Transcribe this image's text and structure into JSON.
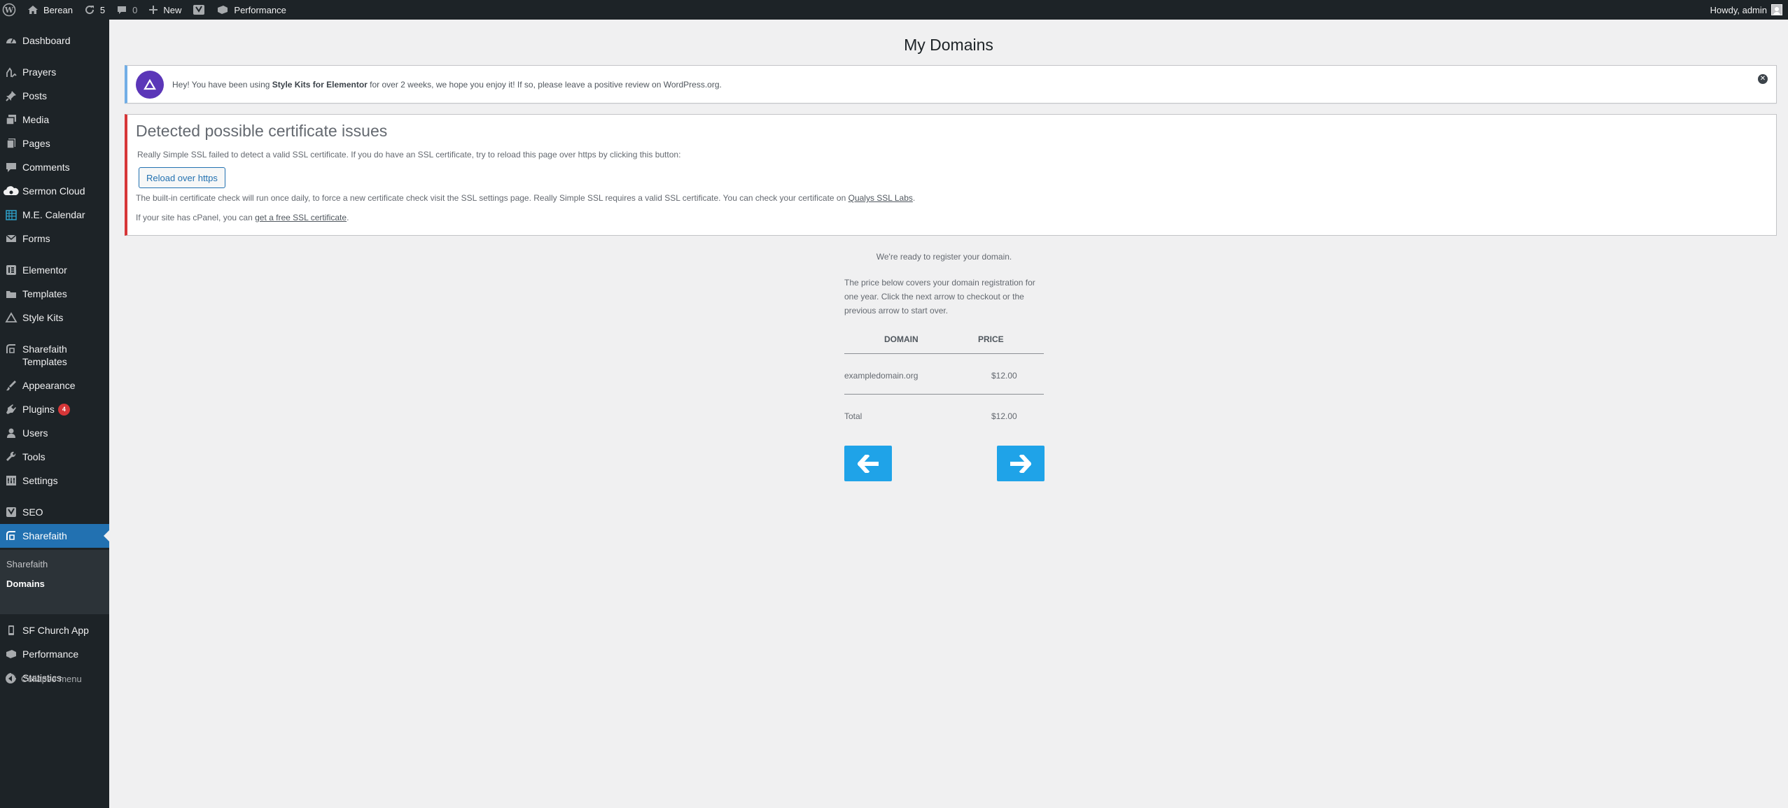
{
  "adminbar": {
    "site_name": "Berean",
    "updates_count": "5",
    "comments_count": "0",
    "new_label": "New",
    "performance_label": "Performance",
    "howdy": "Howdy, admin"
  },
  "sidebar": {
    "items": [
      {
        "label": "Dashboard",
        "icon": "dashboard-icon"
      },
      {
        "label": "Prayers",
        "icon": "prayers-icon"
      },
      {
        "label": "Posts",
        "icon": "posts-icon"
      },
      {
        "label": "Media",
        "icon": "media-icon"
      },
      {
        "label": "Pages",
        "icon": "pages-icon"
      },
      {
        "label": "Comments",
        "icon": "comments-icon"
      },
      {
        "label": "Sermon Cloud",
        "icon": "cloud-icon"
      },
      {
        "label": "M.E. Calendar",
        "icon": "calendar-icon"
      },
      {
        "label": "Forms",
        "icon": "forms-icon"
      },
      {
        "label": "Elementor",
        "icon": "elementor-icon"
      },
      {
        "label": "Templates",
        "icon": "templates-icon"
      },
      {
        "label": "Style Kits",
        "icon": "style-kits-icon"
      },
      {
        "label": "Sharefaith Templates",
        "icon": "sharefaith-templates-icon"
      },
      {
        "label": "Appearance",
        "icon": "appearance-icon"
      },
      {
        "label": "Plugins",
        "icon": "plugins-icon",
        "badge": "4"
      },
      {
        "label": "Users",
        "icon": "users-icon"
      },
      {
        "label": "Tools",
        "icon": "tools-icon"
      },
      {
        "label": "Settings",
        "icon": "settings-icon"
      },
      {
        "label": "SEO",
        "icon": "seo-icon"
      },
      {
        "label": "Sharefaith",
        "icon": "sharefaith-icon"
      },
      {
        "label": "SF Church App",
        "icon": "phone-icon"
      },
      {
        "label": "Performance",
        "icon": "performance-icon"
      },
      {
        "label": "Statistics",
        "icon": "statistics-icon"
      }
    ],
    "submenu": [
      "Sharefaith",
      "Domains"
    ],
    "collapse_label": "Collapse menu",
    "active_color": "#2271b1"
  },
  "main": {
    "title": "My Domains",
    "stylekits_notice": {
      "prefix": "Hey! You have been using ",
      "bold": "Style Kits for Elementor",
      "suffix": " for over 2 weeks, we hope you enjoy it! If so, please leave a positive review on WordPress.org."
    },
    "ssl_notice": {
      "heading": "Detected possible certificate issues",
      "line1": "Really Simple SSL failed to detect a valid SSL certificate. If you do have an SSL certificate, try to reload this page over https by clicking this button:",
      "button": "Reload over https",
      "line2_prefix": "The built-in certificate check will run once daily, to force a new certificate check visit the SSL settings page. Really Simple SSL requires a valid SSL certificate. You can check your certificate on ",
      "line2_link": "Qualys SSL Labs",
      "line2_suffix": ".",
      "line3_prefix": "If your site has cPanel, you can ",
      "line3_link": "get a free SSL certificate",
      "line3_suffix": "."
    },
    "register": {
      "ready": "We're ready to register your domain.",
      "price_text": "The price below covers your domain registration for one year. Click the next arrow to checkout or the previous arrow to start over.",
      "col_domain": "DOMAIN",
      "col_price": "PRICE",
      "domain": "exampledomain.org",
      "price": "$12.00",
      "total_label": "Total",
      "total": "$12.00",
      "button_color": "#1fa3e8"
    }
  }
}
